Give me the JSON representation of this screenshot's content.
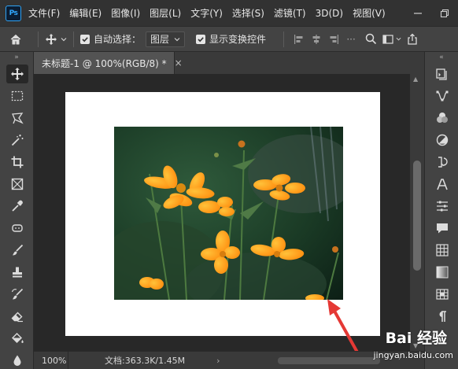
{
  "app": {
    "logo_text": "Ps",
    "menu": [
      "文件(F)",
      "编辑(E)",
      "图像(I)",
      "图层(L)",
      "文字(Y)",
      "选择(S)",
      "滤镜(T)",
      "3D(D)",
      "视图(V)"
    ]
  },
  "options_bar": {
    "auto_select_label": "自动选择：",
    "auto_select_checked": true,
    "layer_select_value": "图层",
    "show_transform_label": "显示变换控件",
    "show_transform_checked": true
  },
  "document": {
    "tab_title": "未标题-1 @ 100%(RGB/8) *",
    "tab_close": "×"
  },
  "status": {
    "zoom": "100%",
    "doc_size": "文档:363.3K/1.45M",
    "arrow": "›"
  },
  "watermark": {
    "brand": "Bai 经验",
    "url": "jingyan.baidu.com"
  },
  "colors": {
    "menubar": "#323232",
    "panel": "#434343",
    "workspace": "#282828",
    "arrow": "#e53935",
    "flower": "#ff9a1f"
  },
  "toolbar_icons": [
    "move-icon",
    "marquee-icon",
    "lasso-icon",
    "magic-wand-icon",
    "crop-icon",
    "frame-icon",
    "eyedropper-icon",
    "healing-brush-icon",
    "brush-icon",
    "clone-stamp-icon",
    "history-brush-icon",
    "eraser-icon",
    "paint-bucket-icon",
    "blur-icon"
  ],
  "panel_icons": [
    "history-icon",
    "paths-icon",
    "color-icon",
    "adjustments-icon",
    "actions-icon",
    "character-icon",
    "properties-icon",
    "comments-icon",
    "swatches-icon",
    "gradients-icon",
    "channels-icon",
    "paragraph-icon"
  ]
}
